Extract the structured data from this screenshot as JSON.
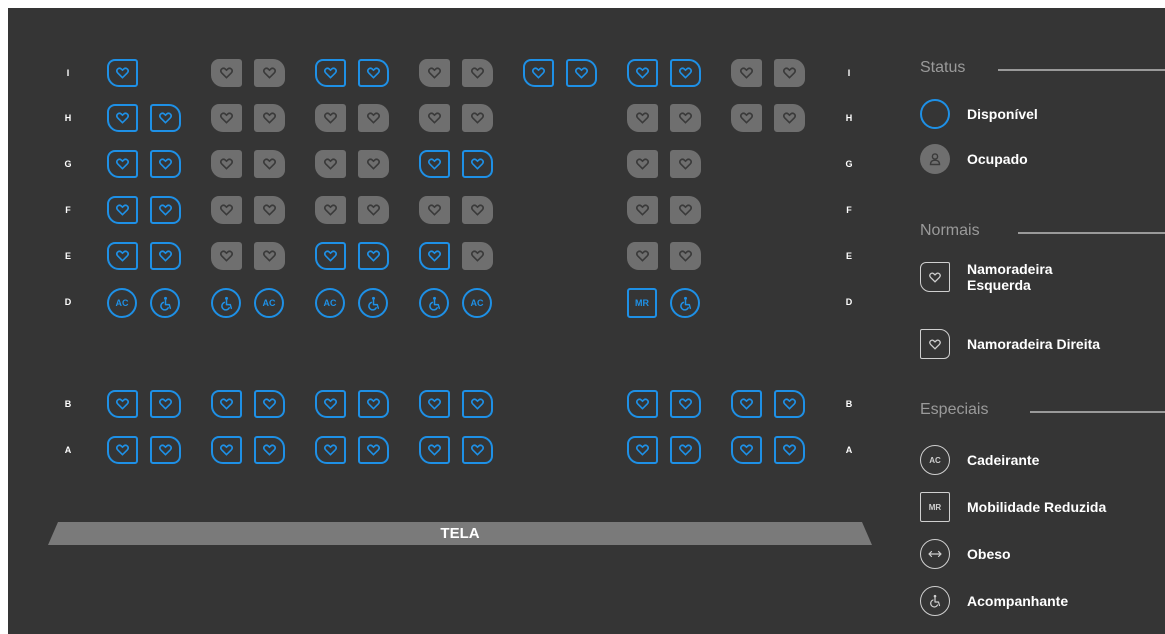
{
  "rows": [
    "I",
    "H",
    "G",
    "F",
    "E",
    "D",
    "B",
    "A"
  ],
  "seats": {
    "I": [
      "love-left:available",
      null,
      "love-left:occupied",
      "love-right:occupied",
      "love-left:available",
      "love-right:available",
      "love-left:occupied",
      "love-right:occupied",
      "love-left:available",
      "love-right:available",
      "love-left:available",
      "love-right:available",
      "love-left:occupied",
      "love-right:occupied"
    ],
    "H": [
      "love-left:available",
      "love-right:available",
      "love-left:occupied",
      "love-right:occupied",
      "love-left:occupied",
      "love-right:occupied",
      "love-left:occupied",
      "love-right:occupied",
      null,
      null,
      "love-left:occupied",
      "love-right:occupied",
      "love-left:occupied",
      "love-right:occupied"
    ],
    "G": [
      "love-left:available",
      "love-right:available",
      "love-left:occupied",
      "love-right:occupied",
      "love-left:occupied",
      "love-right:occupied",
      "love-left:available",
      "love-right:available",
      null,
      null,
      "love-left:occupied",
      "love-right:occupied",
      null,
      null
    ],
    "F": [
      "love-left:available",
      "love-right:available",
      "love-left:occupied",
      "love-right:occupied",
      "love-left:occupied",
      "love-right:occupied",
      "love-left:occupied",
      "love-right:occupied",
      null,
      null,
      "love-left:occupied",
      "love-right:occupied",
      null,
      null
    ],
    "E": [
      "love-left:available",
      "love-right:available",
      "love-left:occupied",
      "love-right:occupied",
      "love-left:available",
      "love-right:available",
      "love-left:available",
      "love-right:occupied",
      null,
      null,
      "love-left:occupied",
      "love-right:occupied",
      null,
      null
    ],
    "D": [
      "wheelchair:available",
      "companion:available",
      "companion:available",
      "wheelchair:available",
      "wheelchair:available",
      "companion:available",
      "companion:available",
      "wheelchair:available",
      null,
      null,
      "reduced-mobility:available",
      "companion:available",
      null,
      null
    ],
    "B": [
      "love-left:available",
      "love-right:available",
      "love-left:available",
      "love-right:available",
      "love-left:available",
      "love-right:available",
      "love-left:available",
      "love-right:available",
      null,
      null,
      "love-left:available",
      "love-right:available",
      "love-left:available",
      "love-right:available"
    ],
    "A": [
      "love-left:available",
      "love-right:available",
      "love-left:available",
      "love-right:available",
      "love-left:available",
      "love-right:available",
      "love-left:available",
      "love-right:available",
      null,
      null,
      "love-left:available",
      "love-right:available",
      "love-left:available",
      "love-right:available"
    ]
  },
  "seat_codes": {
    "wheelchair": "AC",
    "reduced_mobility": "MR"
  },
  "screen_label": "TELA",
  "colors": {
    "background": "#353535",
    "available": "#1e90e6",
    "occupied": "#6f6f6f",
    "legend_gray": "#9a9a9a",
    "text": "#ffffff"
  },
  "legend": {
    "status": {
      "title": "Status",
      "items": [
        {
          "icon": "available-circle-icon",
          "label": "Disponível"
        },
        {
          "icon": "occupied-person-icon",
          "label": "Ocupado"
        }
      ]
    },
    "normais": {
      "title": "Normais",
      "items": [
        {
          "icon": "loveseat-left-icon",
          "label": "Namoradeira Esquerda"
        },
        {
          "icon": "loveseat-right-icon",
          "label": "Namoradeira Direita"
        }
      ]
    },
    "especiais": {
      "title": "Especiais",
      "items": [
        {
          "icon": "wheelchair-icon",
          "code": "AC",
          "label": "Cadeirante"
        },
        {
          "icon": "reduced-mobility-icon",
          "code": "MR",
          "label": "Mobilidade Reduzida"
        },
        {
          "icon": "obese-icon",
          "label": "Obeso"
        },
        {
          "icon": "companion-icon",
          "label": "Acompanhante"
        }
      ]
    }
  }
}
